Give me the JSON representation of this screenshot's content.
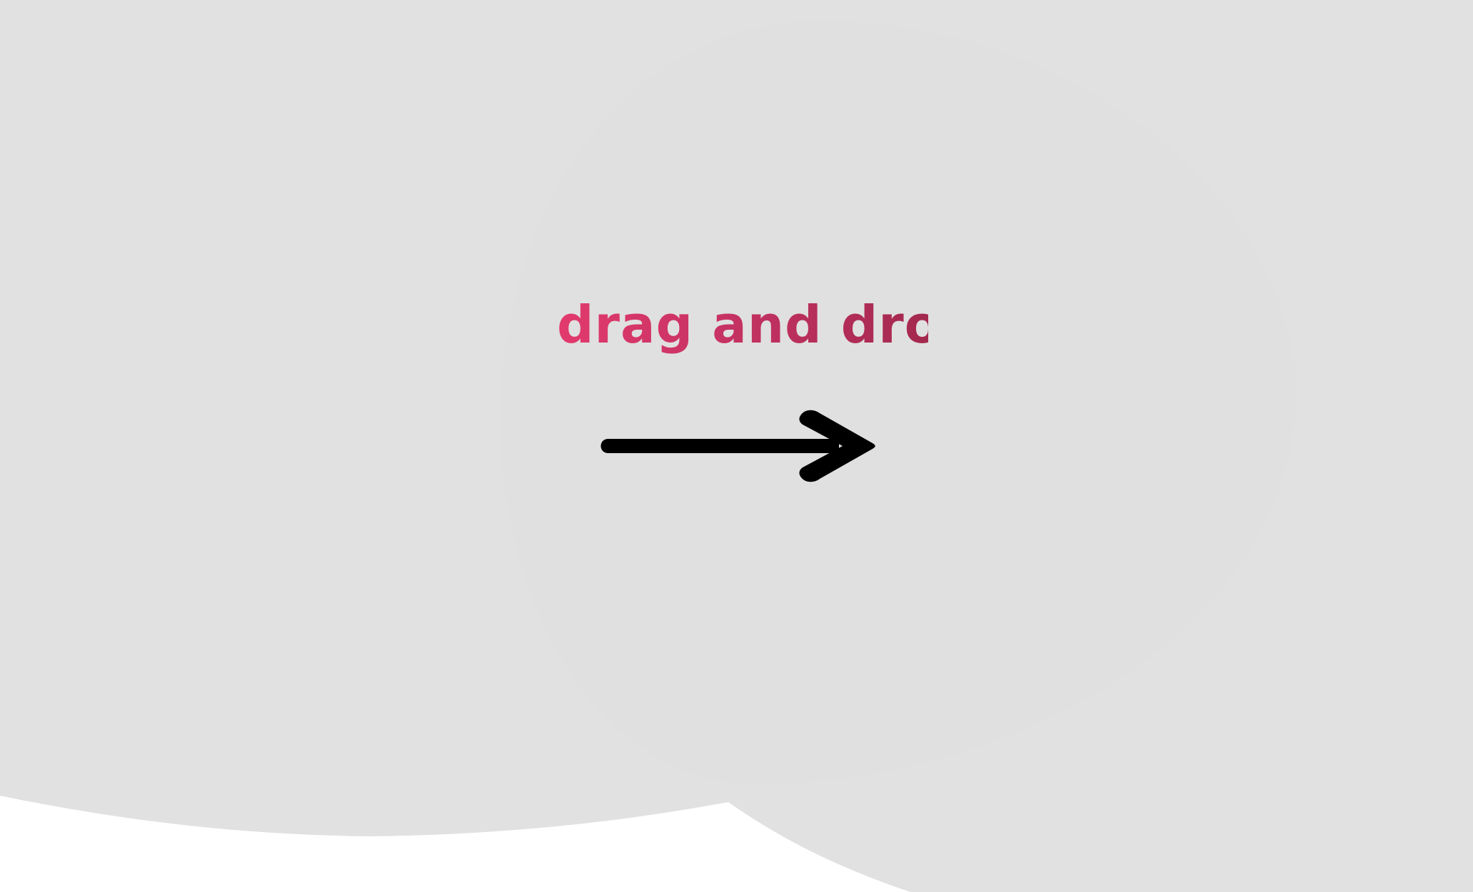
{
  "drop_zone": {
    "title": "drag and drop",
    "title_gradient": [
      "#e23a6e",
      "#a3294f"
    ],
    "arrow_icon": "arrow-right-icon",
    "arrow_color": "#000000"
  },
  "background": {
    "shape_color": "#e1e1e1",
    "base_color": "#ffffff"
  }
}
